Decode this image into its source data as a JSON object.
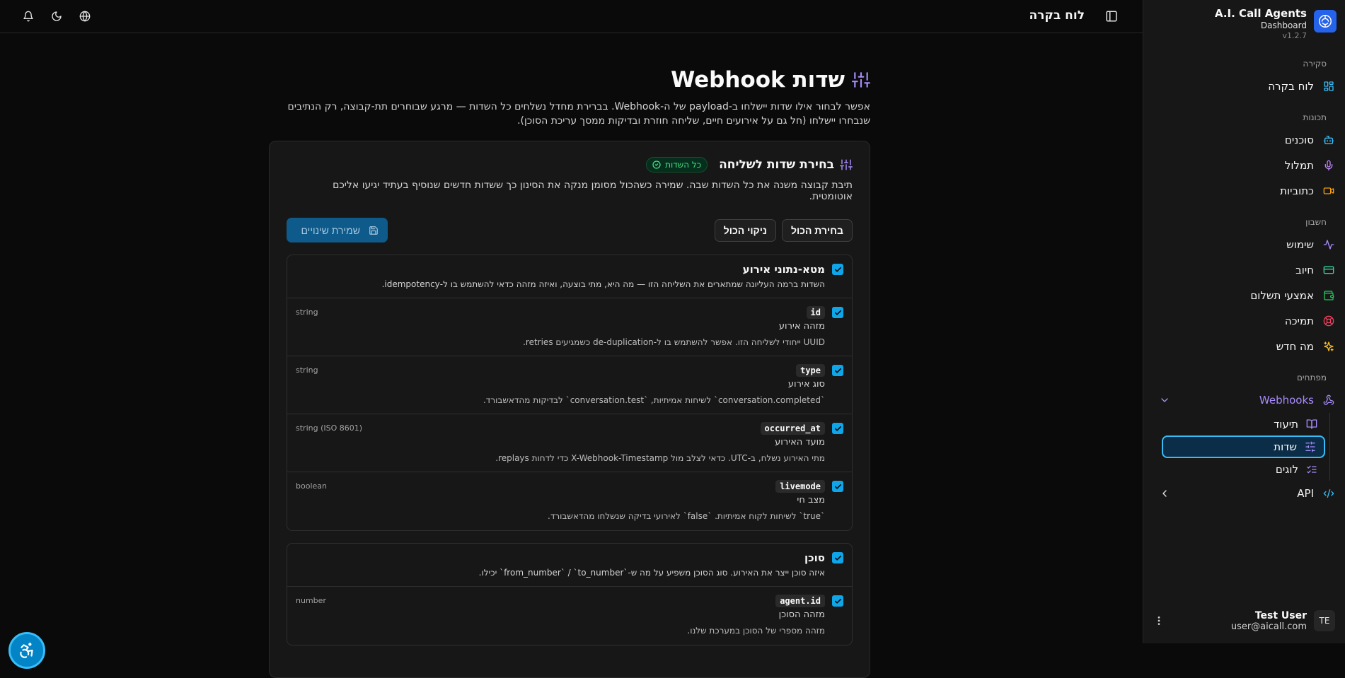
{
  "brand": {
    "title": "A.I. Call Agents",
    "subtitle": "Dashboard",
    "version": "v1.2.7"
  },
  "sidebar": {
    "groups": [
      {
        "label": "סקירה",
        "items": [
          {
            "label": "לוח בקרה",
            "icon": "dashboard-grid-icon"
          }
        ]
      },
      {
        "label": "תכונות",
        "items": [
          {
            "label": "סוכנים",
            "icon": "bot-icon"
          },
          {
            "label": "תמלול",
            "icon": "mic-icon"
          },
          {
            "label": "כתוביות",
            "icon": "video-icon"
          }
        ]
      },
      {
        "label": "חשבון",
        "items": [
          {
            "label": "שימוש",
            "icon": "activity-icon"
          },
          {
            "label": "חיוב",
            "icon": "credit-card-icon"
          },
          {
            "label": "אמצעי תשלום",
            "icon": "wallet-icon"
          },
          {
            "label": "תמיכה",
            "icon": "lifebuoy-icon"
          },
          {
            "label": "מה חדש",
            "icon": "sparkles-icon"
          }
        ]
      },
      {
        "label": "מפתחים",
        "items": [
          {
            "label": "Webhooks",
            "icon": "webhook-icon",
            "children": [
              {
                "label": "תיעוד",
                "icon": "book-icon"
              },
              {
                "label": "שדות",
                "icon": "sliders-icon",
                "active": true
              },
              {
                "label": "לוגים",
                "icon": "list-checks-icon"
              }
            ]
          },
          {
            "label": "API",
            "icon": "code-icon"
          }
        ]
      }
    ],
    "user": {
      "initials": "TE",
      "name": "Test User",
      "email": "user@aicall.com"
    }
  },
  "topbar": {
    "title": "לוח בקרה"
  },
  "page": {
    "title": "שדות Webhook",
    "description": "אפשר לבחור אילו שדות יישלחו ב-payload של ה-Webhook. בברירת מחדל נשלחים כל השדות — מרגע שבוחרים תת-קבוצה, רק הנתיבים שנבחרו יישלחו (חל גם על אירועים חיים, שליחה חוזרת ובדיקות ממסך עריכת הסוכן)."
  },
  "card": {
    "title": "בחירת שדות לשליחה",
    "badge": "כל השדות",
    "description": "תיבת קבוצה משנה את כל השדות שבה. שמירה כשהכול מסומן מנקה את הסינון כך ששדות חדשים שנוסיף בעתיד יגיעו אליכם אוטומטית.",
    "select_all": "בחירת הכול",
    "clear_all": "ניקוי הכול",
    "save": "שמירת שינויים"
  },
  "groups": [
    {
      "title": "מטא-נתוני אירוע",
      "description": "השדות ברמה העליונה שמתארים את השליחה הזו — מה היא, מתי בוצעה, ואיזה מזהה כדאי להשתמש בו ל-idempotency.",
      "fields": [
        {
          "key": "id",
          "type": "string",
          "label": "מזהה אירוע",
          "description": "UUID ייחודי לשליחה הזו. אפשר להשתמש בו ל-de-duplication כשמגיעים retries."
        },
        {
          "key": "type",
          "type": "string",
          "label": "סוג אירוע",
          "description": "`conversation.completed` לשיחות אמיתיות, `conversation.test` לבדיקות מהדאשבורד."
        },
        {
          "key": "occurred_at",
          "type": "string (ISO 8601)",
          "label": "מועד האירוע",
          "description": "מתי האירוע נשלח, ב-UTC. כדאי לצלב מול X-Webhook-Timestamp כדי לדחות replays."
        },
        {
          "key": "livemode",
          "type": "boolean",
          "label": "מצב חי",
          "description": "`true` לשיחות לקוח אמיתיות. `false` לאירועי בדיקה שנשלחו מהדאשבורד."
        }
      ]
    },
    {
      "title": "סוכן",
      "description": "איזה סוכן ייצר את האירוע. סוג הסוכן משפיע על מה ש-`from_number` / `to_number` יכילו.",
      "fields": [
        {
          "key": "agent.id",
          "type": "number",
          "label": "מזהה הסוכן",
          "description": "מזהה מספרי של הסוכן במערכת שלנו."
        }
      ]
    }
  ],
  "colors": {
    "accent": "#0ea5e9",
    "purple": "#a78bfa",
    "success": "#4ade80",
    "save_button": "#0e5a8a"
  }
}
